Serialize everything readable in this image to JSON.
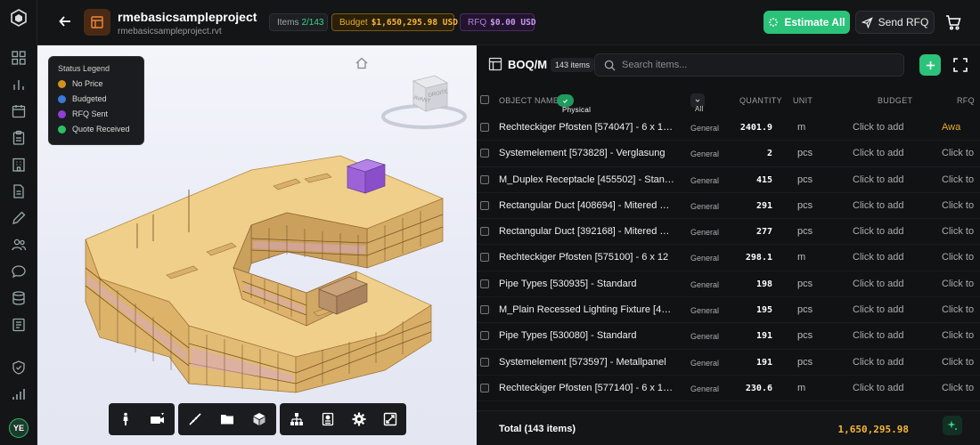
{
  "header": {
    "project_title": "rmebasicsampleproject",
    "project_file": "rmebasicsampleproject.rvt",
    "items_label": "Items",
    "items_value": "2/143",
    "budget_label": "Budget",
    "budget_value": "$1,650,295.98 USD",
    "rfq_label": "RFQ",
    "rfq_value": "$0.00 USD",
    "estimate_all_label": "Estimate All",
    "send_rfq_label": "Send RFQ"
  },
  "sidebar": {
    "avatar_initials": "YE"
  },
  "legend": {
    "title": "Status Legend",
    "items": [
      {
        "label": "No Price",
        "color": "#d4911c"
      },
      {
        "label": "Budgeted",
        "color": "#3a7ad8"
      },
      {
        "label": "RFQ Sent",
        "color": "#8d3fd6"
      },
      {
        "label": "Quote Received",
        "color": "#2bbf62"
      }
    ]
  },
  "viewcube": {
    "face_front": "AVANT",
    "face_right": "DROITE"
  },
  "boq": {
    "title": "BOQ/M",
    "count_badge": "143 items",
    "search_placeholder": "Search items...",
    "columns": {
      "name": "OBJECT NAME",
      "filter_tag": "Physical",
      "category_filter": "All",
      "quantity": "QUANTITY",
      "unit": "UNIT",
      "budget": "BUDGET",
      "rfq": "RFQ"
    },
    "rows": [
      {
        "name": "Rechteckiger Pfosten [574047] - 6 x 15 ...",
        "category": "General",
        "quantity": "2401.9",
        "unit": "m",
        "budget": "Click to add",
        "rfq": "Awa"
      },
      {
        "name": "Systemelement [573828] - Verglasung",
        "category": "General",
        "quantity": "2",
        "unit": "pcs",
        "budget": "Click to add",
        "rfq": "Click to"
      },
      {
        "name": "M_Duplex Receptacle [455502] - Stand...",
        "category": "General",
        "quantity": "415",
        "unit": "pcs",
        "budget": "Click to add",
        "rfq": "Click to"
      },
      {
        "name": "Rectangular Duct [408694] - Mitered El...",
        "category": "General",
        "quantity": "291",
        "unit": "pcs",
        "budget": "Click to add",
        "rfq": "Click to"
      },
      {
        "name": "Rectangular Duct [392168] - Mitered Elb...",
        "category": "General",
        "quantity": "277",
        "unit": "pcs",
        "budget": "Click to add",
        "rfq": "Click to"
      },
      {
        "name": "Rechteckiger Pfosten [575100] - 6 x 12",
        "category": "General",
        "quantity": "298.1",
        "unit": "m",
        "budget": "Click to add",
        "rfq": "Click to"
      },
      {
        "name": "Pipe Types [530935] - Standard",
        "category": "General",
        "quantity": "198",
        "unit": "pcs",
        "budget": "Click to add",
        "rfq": "Click to"
      },
      {
        "name": "M_Plain Recessed Lighting Fixture [4316...",
        "category": "General",
        "quantity": "195",
        "unit": "pcs",
        "budget": "Click to add",
        "rfq": "Click to"
      },
      {
        "name": "Pipe Types [530080] - Standard",
        "category": "General",
        "quantity": "191",
        "unit": "pcs",
        "budget": "Click to add",
        "rfq": "Click to"
      },
      {
        "name": "Systemelement [573597] - Metallpanel",
        "category": "General",
        "quantity": "191",
        "unit": "pcs",
        "budget": "Click to add",
        "rfq": "Click to"
      },
      {
        "name": "Rechteckiger Pfosten [577140] - 6 x 10 ...",
        "category": "General",
        "quantity": "230.6",
        "unit": "m",
        "budget": "Click to add",
        "rfq": "Click to"
      }
    ],
    "total_label": "Total (143 items)",
    "total_value": "1,650,295.98"
  }
}
